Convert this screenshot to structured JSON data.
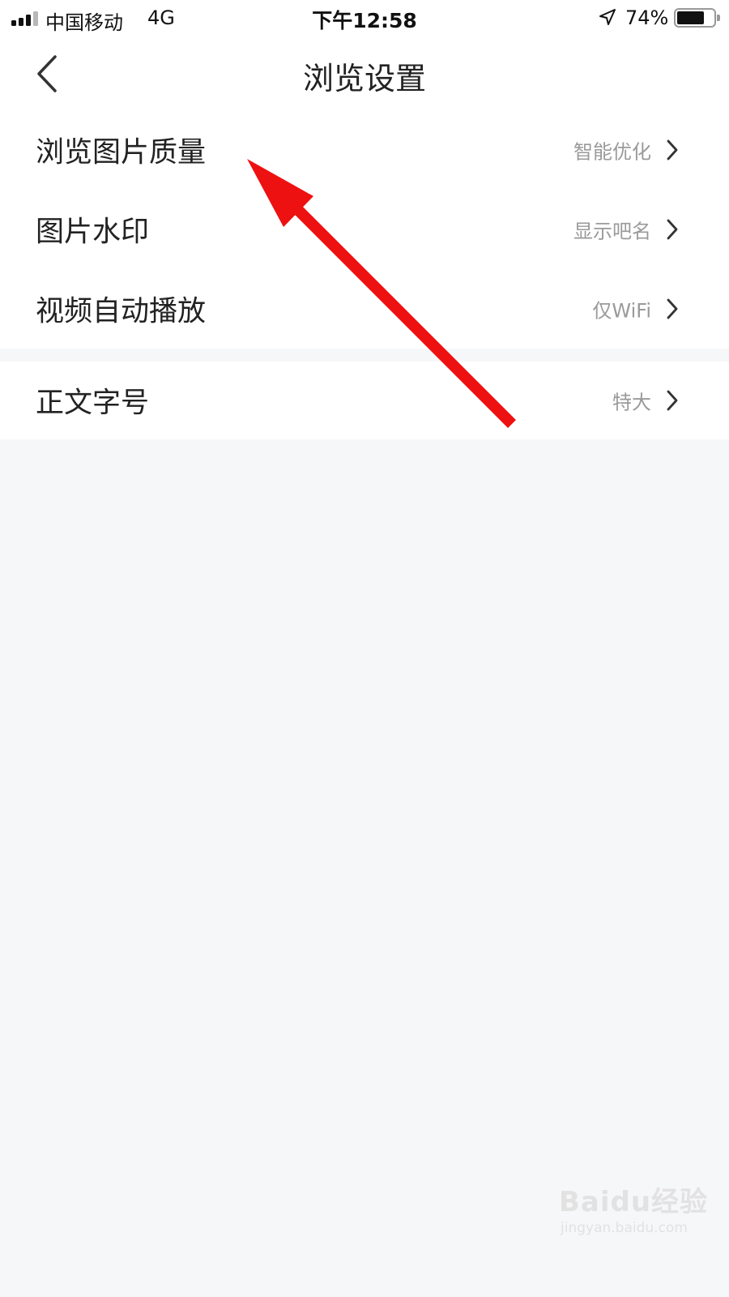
{
  "status_bar": {
    "carrier": "中国移动",
    "network": "4G",
    "time": "下午12:58",
    "battery_percent": "74%",
    "battery_level": 0.74
  },
  "nav": {
    "title": "浏览设置",
    "back_icon": "chevron-left-icon"
  },
  "settings": {
    "group1": [
      {
        "label": "浏览图片质量",
        "value": "智能优化"
      },
      {
        "label": "图片水印",
        "value": "显示吧名"
      },
      {
        "label": "视频自动播放",
        "value": "仅WiFi"
      }
    ],
    "group2": [
      {
        "label": "正文字号",
        "value": "特大"
      }
    ]
  },
  "annotation": {
    "type": "arrow",
    "color": "#ee1111"
  },
  "watermark": {
    "brand": "Baidu经验",
    "url": "jingyan.baidu.com"
  }
}
